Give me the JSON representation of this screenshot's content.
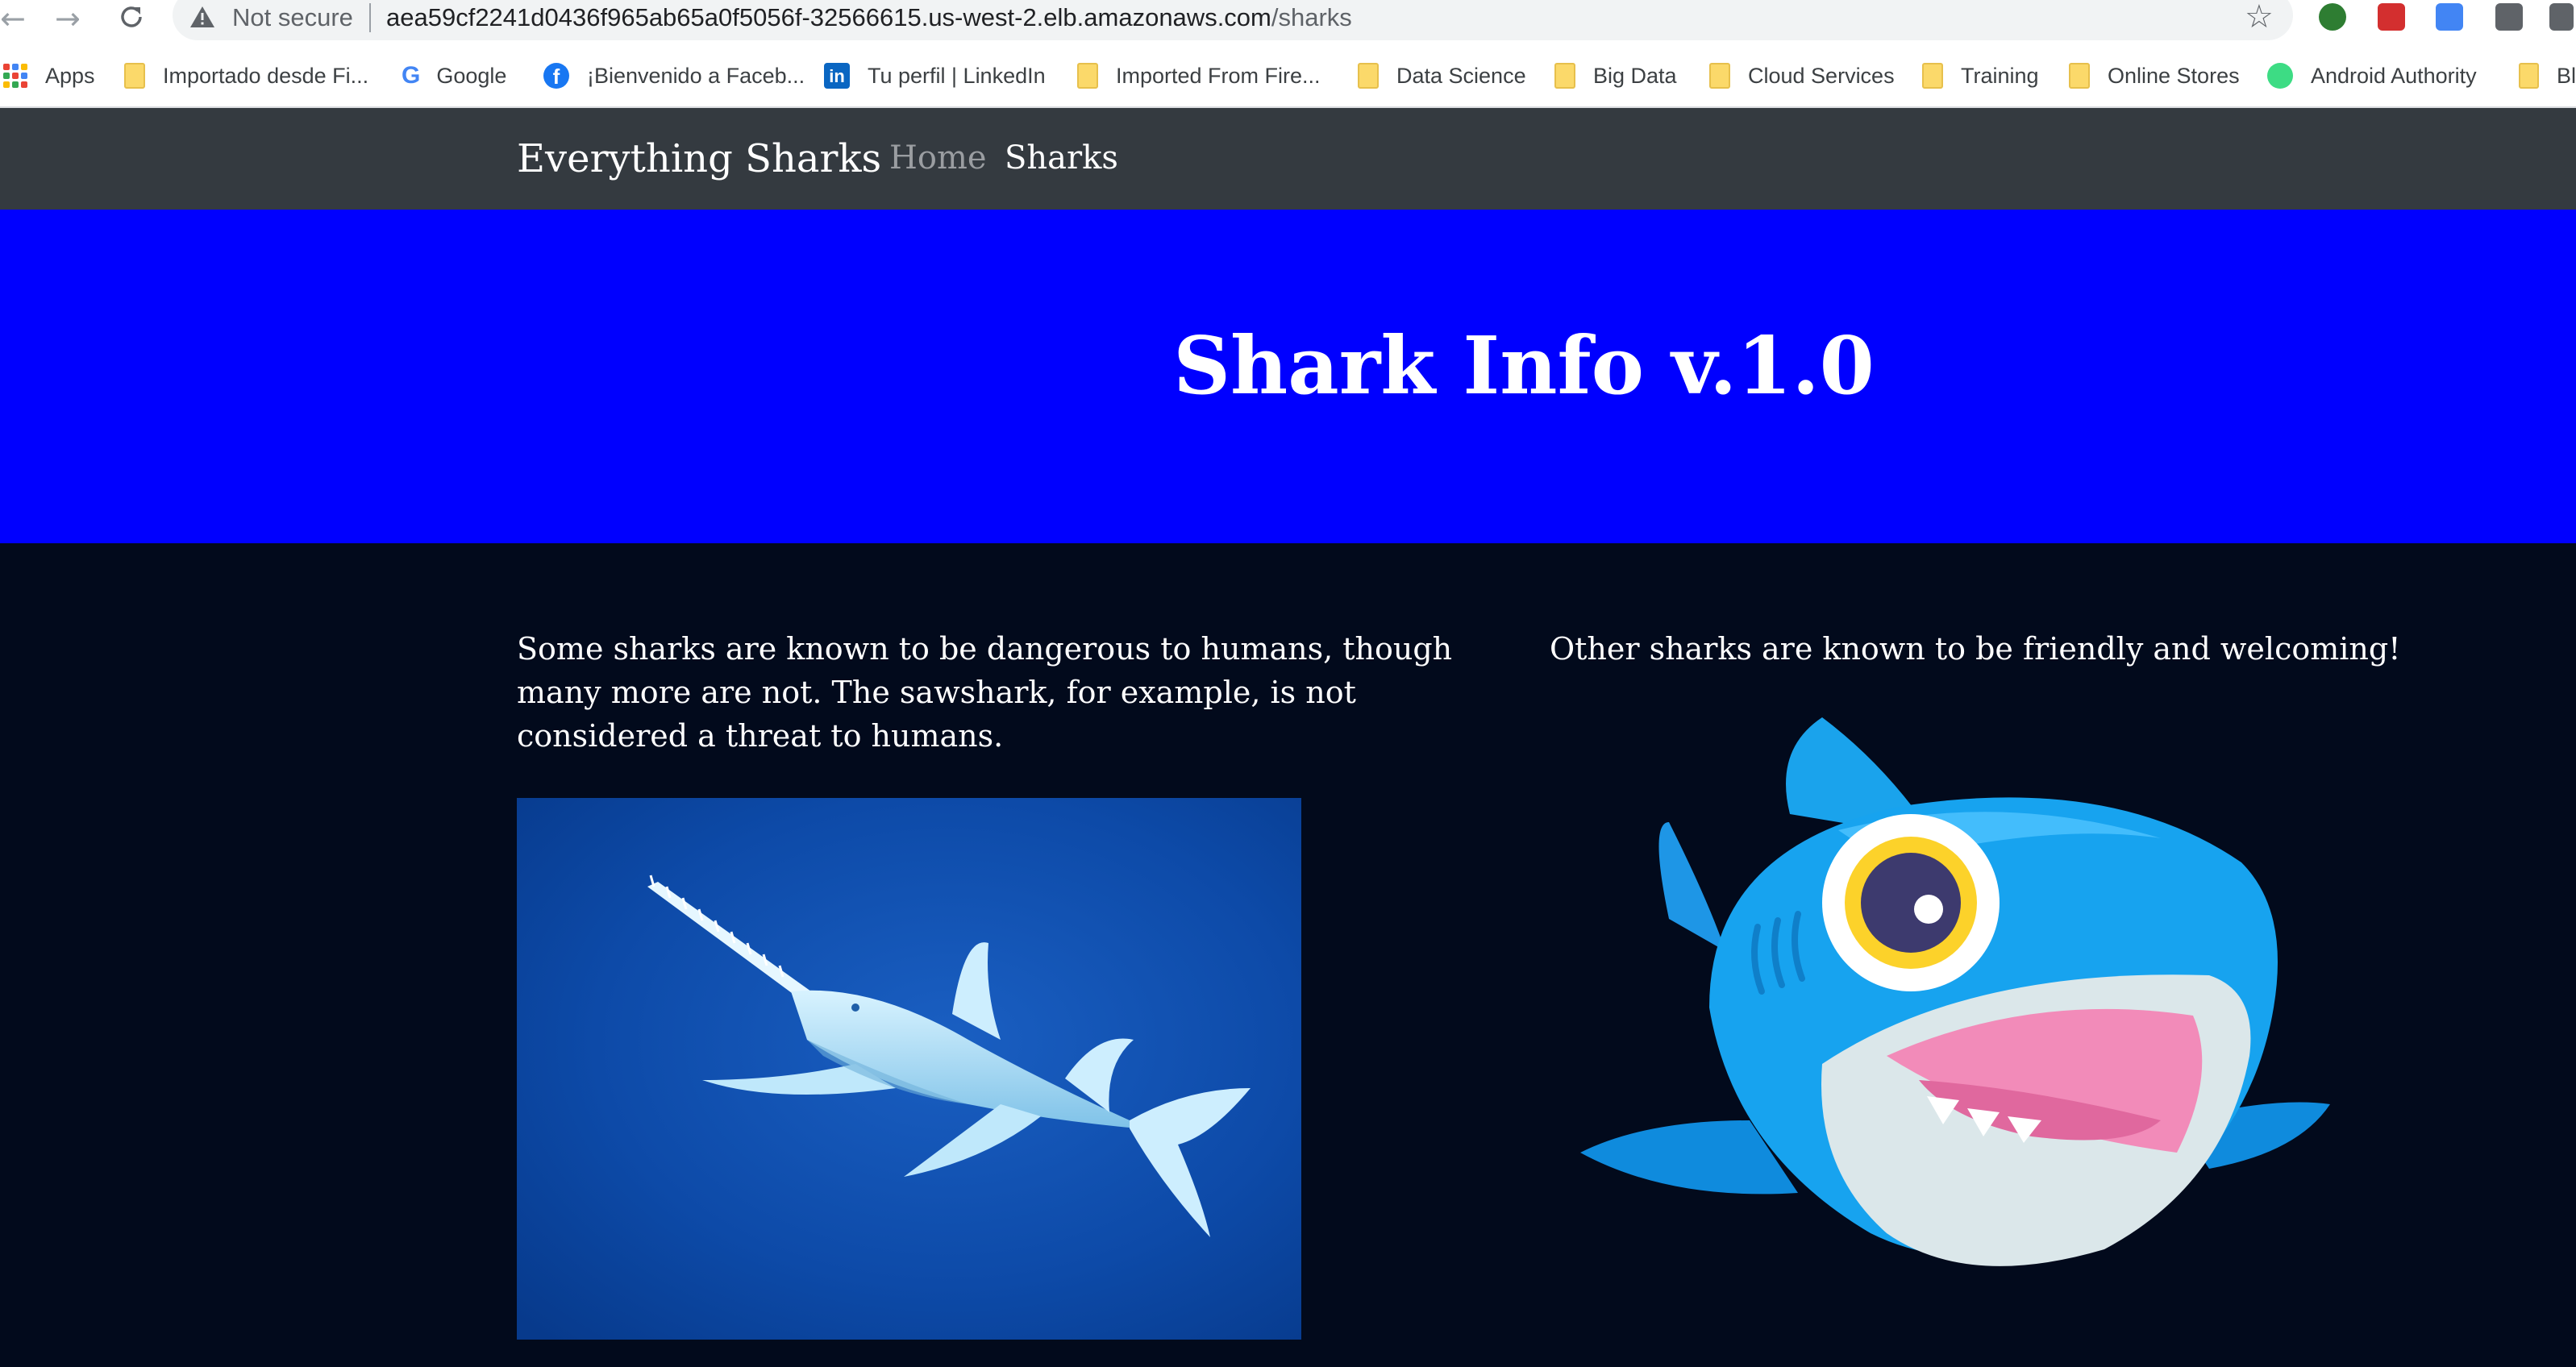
{
  "browser": {
    "security_label": "Not secure",
    "url_host": "aea59cf2241d0436f965ab65a0f5056f-32566615.us-west-2.elb.amazonaws.com",
    "url_path": "/sharks",
    "back_icon": "arrow-left-icon",
    "forward_icon": "arrow-right-icon",
    "reload_icon": "reload-icon",
    "star_icon": "star-icon"
  },
  "bookmarks": [
    {
      "label": "Apps",
      "icon": "apps-grid-icon"
    },
    {
      "label": "Importado desde Fi...",
      "icon": "folder-icon"
    },
    {
      "label": "Google",
      "icon": "google-icon"
    },
    {
      "label": "¡Bienvenido a Faceb...",
      "icon": "facebook-icon"
    },
    {
      "label": "Tu perfil | LinkedIn",
      "icon": "linkedin-icon"
    },
    {
      "label": "Imported From Fire...",
      "icon": "folder-icon"
    },
    {
      "label": "Data Science",
      "icon": "folder-icon"
    },
    {
      "label": "Big Data",
      "icon": "folder-icon"
    },
    {
      "label": "Cloud Services",
      "icon": "folder-icon"
    },
    {
      "label": "Training",
      "icon": "folder-icon"
    },
    {
      "label": "Online Stores",
      "icon": "folder-icon"
    },
    {
      "label": "Android Authority",
      "icon": "android-icon"
    },
    {
      "label": "Bl",
      "icon": "folder-icon"
    }
  ],
  "site": {
    "brand": "Everything Sharks",
    "nav": {
      "home": "Home",
      "sharks": "Sharks"
    },
    "hero_title": "Shark Info v.1.0",
    "left_paragraph": "Some sharks are known to be dangerous to humans, though many more are not. The sawshark, for example, is not considered a threat to humans.",
    "right_paragraph": "Other sharks are known to be friendly and welcoming!"
  },
  "colors": {
    "hero_bg": "#0000ff",
    "nav_bg": "#343a40",
    "page_bg": "#020a1c",
    "nav_inactive": "#9a9da1"
  }
}
